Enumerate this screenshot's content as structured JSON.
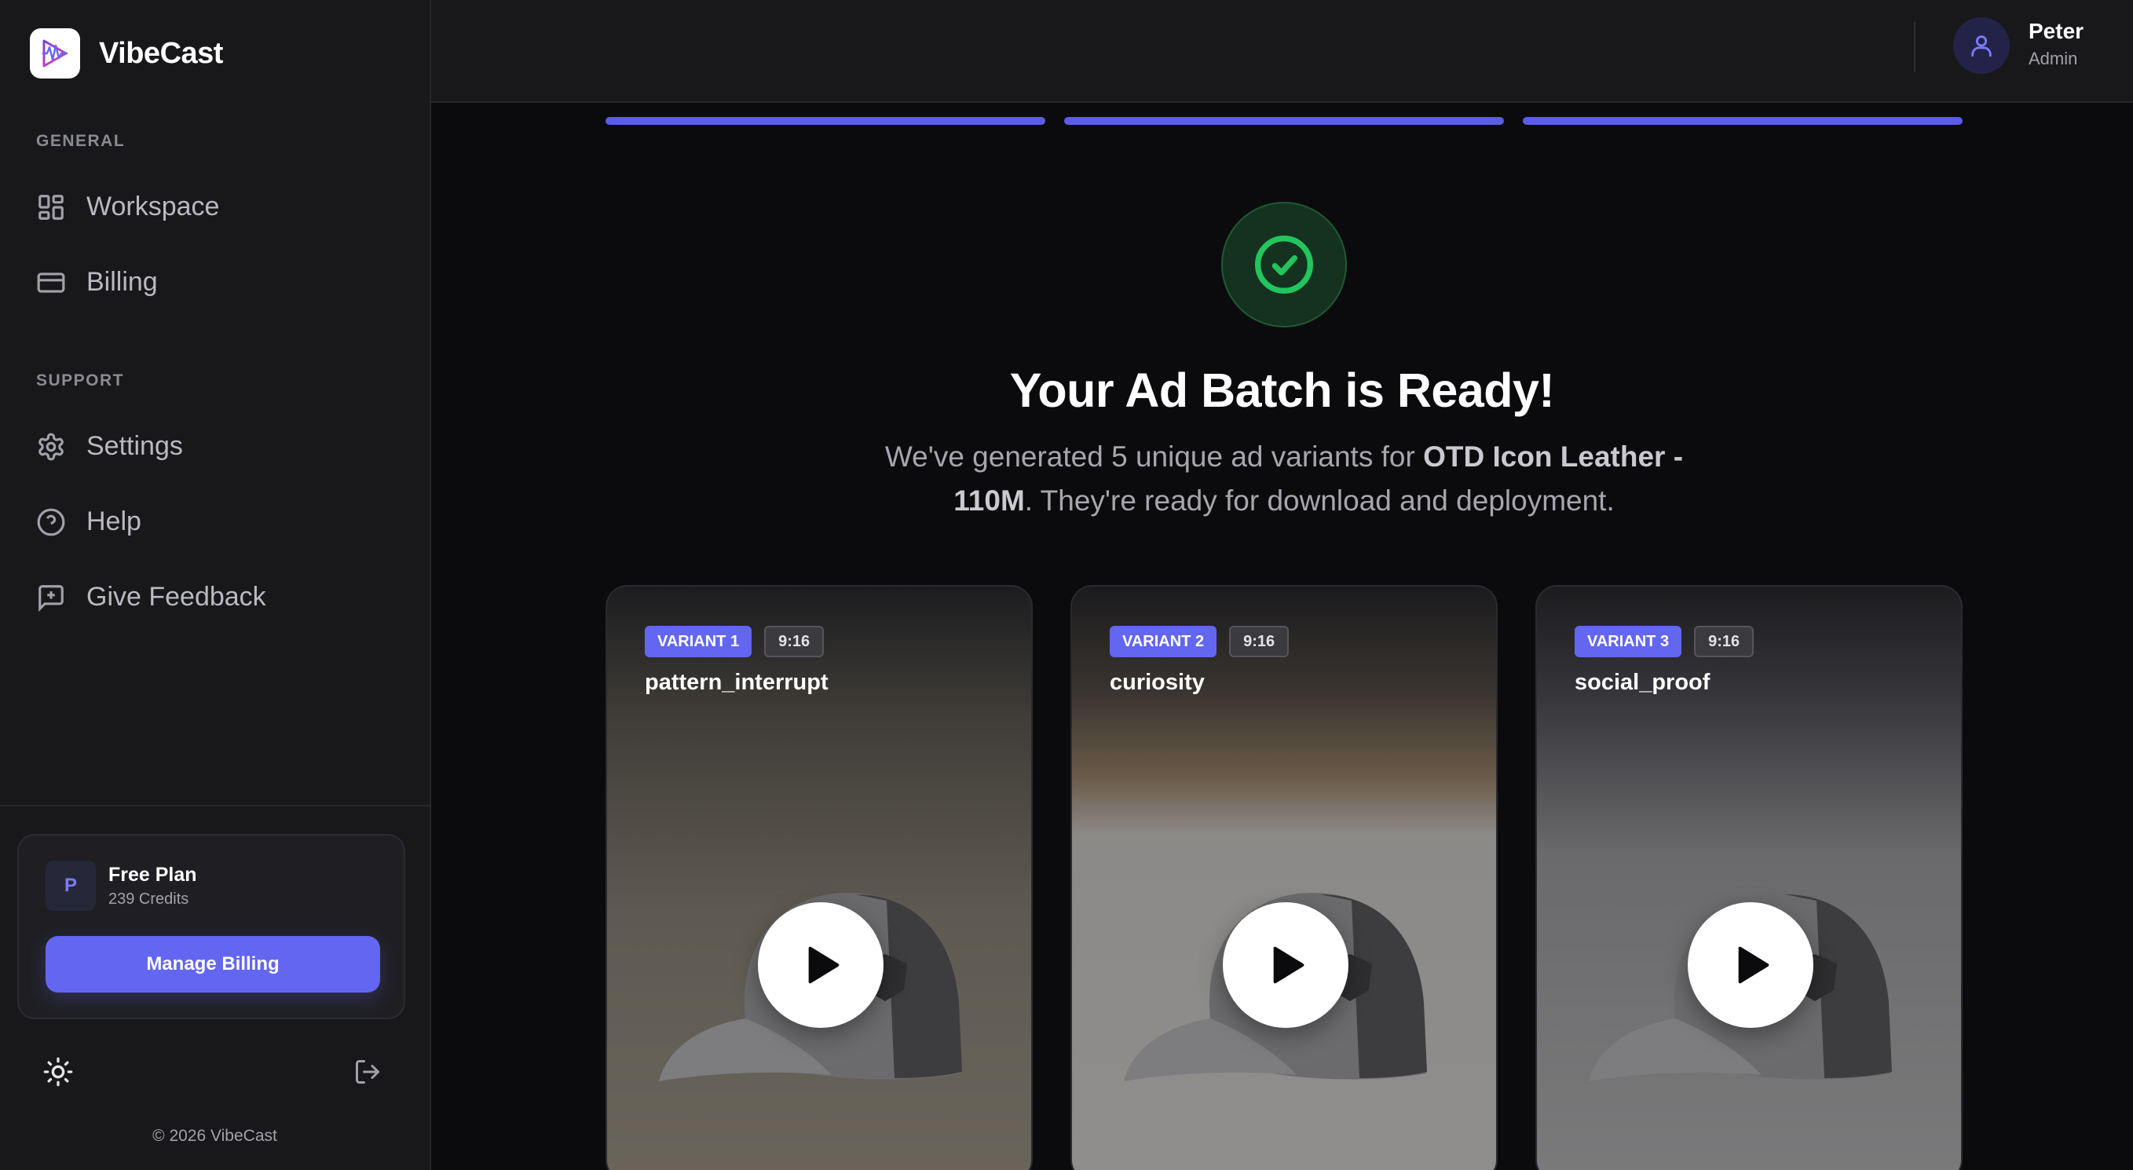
{
  "brand": {
    "name": "VibeCast",
    "logo_icon": "waveform-logo-icon"
  },
  "sidebar": {
    "general_title": "GENERAL",
    "support_title": "SUPPORT",
    "general_items": [
      {
        "label": "Workspace",
        "icon": "grid-icon"
      },
      {
        "label": "Billing",
        "icon": "credit-card-icon"
      }
    ],
    "support_items": [
      {
        "label": "Settings",
        "icon": "gear-icon"
      },
      {
        "label": "Help",
        "icon": "help-circle-icon"
      },
      {
        "label": "Give Feedback",
        "icon": "feedback-icon"
      }
    ],
    "plan": {
      "avatar_letter": "P",
      "name": "Free Plan",
      "credits": "239 Credits",
      "button_label": "Manage Billing"
    },
    "copyright": "© 2026 VibeCast"
  },
  "user": {
    "name": "Peter",
    "role": "Admin"
  },
  "progress": {
    "steps_total": 3,
    "steps_done": 3
  },
  "main": {
    "headline": "Your Ad Batch is Ready!",
    "subline_prefix": "We've generated 5 unique ad variants for ",
    "subline_product": "OTD Icon Leather - 110M",
    "subline_suffix": ". They're ready for download and deployment.",
    "variants": [
      {
        "badge": "VARIANT 1",
        "ratio": "9:16",
        "title": "pattern_interrupt"
      },
      {
        "badge": "VARIANT 2",
        "ratio": "9:16",
        "title": "curiosity"
      },
      {
        "badge": "VARIANT 3",
        "ratio": "9:16",
        "title": "social_proof"
      }
    ]
  },
  "colors": {
    "accent": "#6366f1",
    "success": "#22c55e",
    "sidebar_bg": "#18181b",
    "main_bg": "#0b0b0d"
  }
}
